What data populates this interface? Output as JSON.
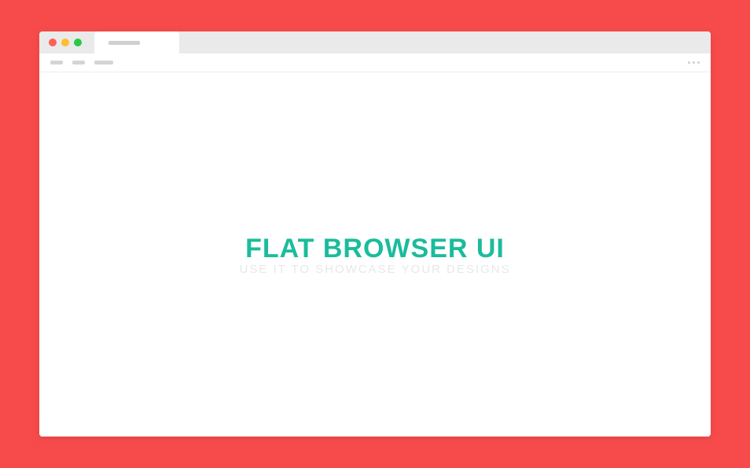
{
  "colors": {
    "background": "#f74b4b",
    "accent": "#1abc9c",
    "chrome": "#eaeaea",
    "trafficRed": "#ff5f57",
    "trafficYellow": "#ffbd2e",
    "trafficGreen": "#28ca42"
  },
  "content": {
    "title": "FLAT BROWSER UI",
    "subtitle": "USE IT TO SHOWCASE YOUR DESIGNS"
  }
}
